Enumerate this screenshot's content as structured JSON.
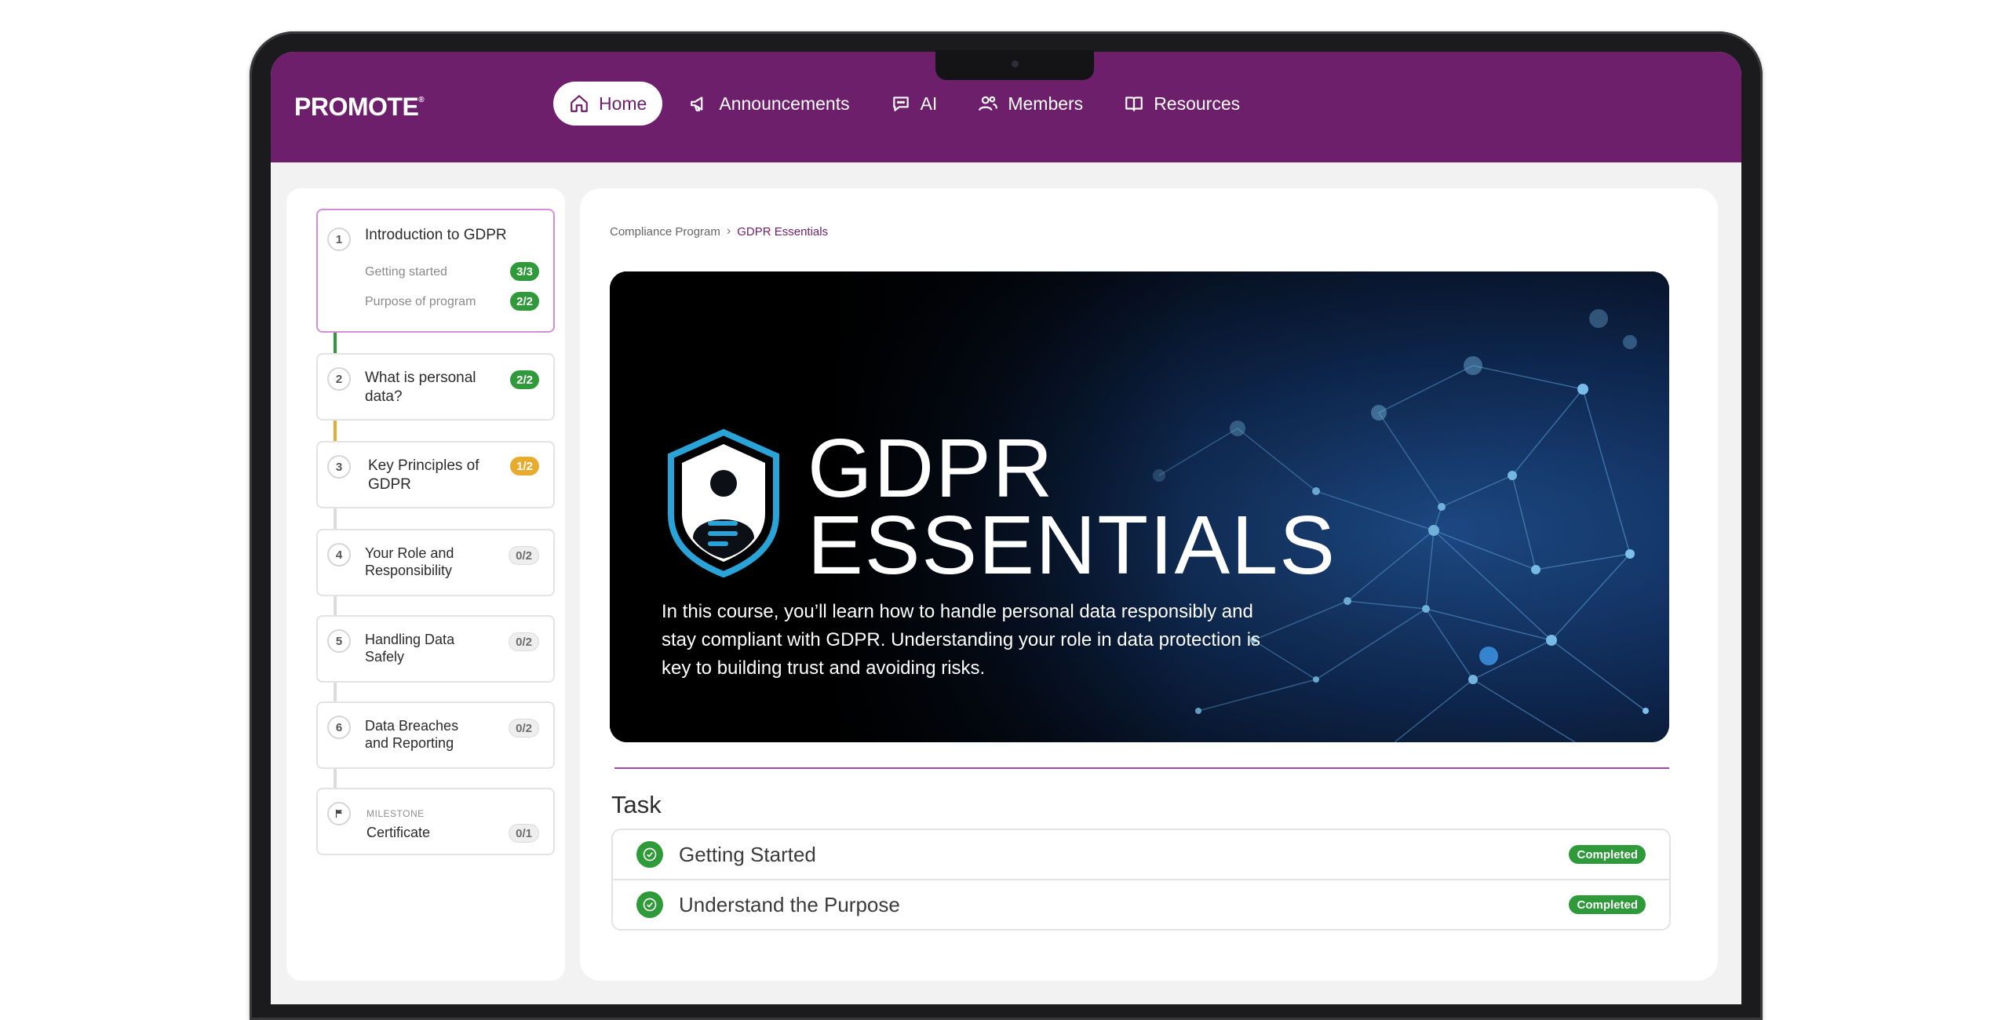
{
  "brand": {
    "logo": "PROMOTE",
    "reg": "®"
  },
  "nav": [
    {
      "label": "Home",
      "icon": "home-icon",
      "active": true
    },
    {
      "label": "Announcements",
      "icon": "megaphone-icon"
    },
    {
      "label": "AI",
      "icon": "chat-bubble-icon"
    },
    {
      "label": "Members",
      "icon": "users-icon"
    },
    {
      "label": "Resources",
      "icon": "book-icon"
    }
  ],
  "sidebar": {
    "steps": [
      {
        "num": "1",
        "title": "Introduction to GDPR",
        "subs": [
          {
            "label": "Getting started",
            "badge": "3/3"
          },
          {
            "label": "Purpose of program",
            "badge": "2/2"
          }
        ]
      },
      {
        "num": "2",
        "title": "What is personal data?",
        "badge": "2/2"
      },
      {
        "num": "3",
        "title": "Key Principles of GDPR",
        "badge": "1/2"
      },
      {
        "num": "4",
        "title": "Your Role and Responsibility",
        "badge": "0/2"
      },
      {
        "num": "5",
        "title": "Handling Data Safely",
        "badge": "0/2"
      },
      {
        "num": "6",
        "title": "Data Breaches and Reporting",
        "badge": "0/2"
      }
    ],
    "milestone": {
      "label": "MILESTONE",
      "title": "Certificate",
      "badge": "0/1"
    }
  },
  "breadcrumb": {
    "parent": "Compliance Program",
    "current": "GDPR Essentials"
  },
  "hero": {
    "title_line1": "GDPR",
    "title_line2": "ESSENTIALS",
    "description": "In this course, you’ll learn how to handle personal data responsibly and stay compliant with GDPR. Understanding your role in data protection is key to building trust and avoiding risks."
  },
  "task": {
    "heading": "Task",
    "items": [
      {
        "name": "Getting Started",
        "status": "Completed"
      },
      {
        "name": "Understand the Purpose",
        "status": "Completed"
      }
    ]
  },
  "colors": {
    "brand": "#6d1f6c",
    "success": "#2f9a3a",
    "warning": "#e7ac2d"
  }
}
